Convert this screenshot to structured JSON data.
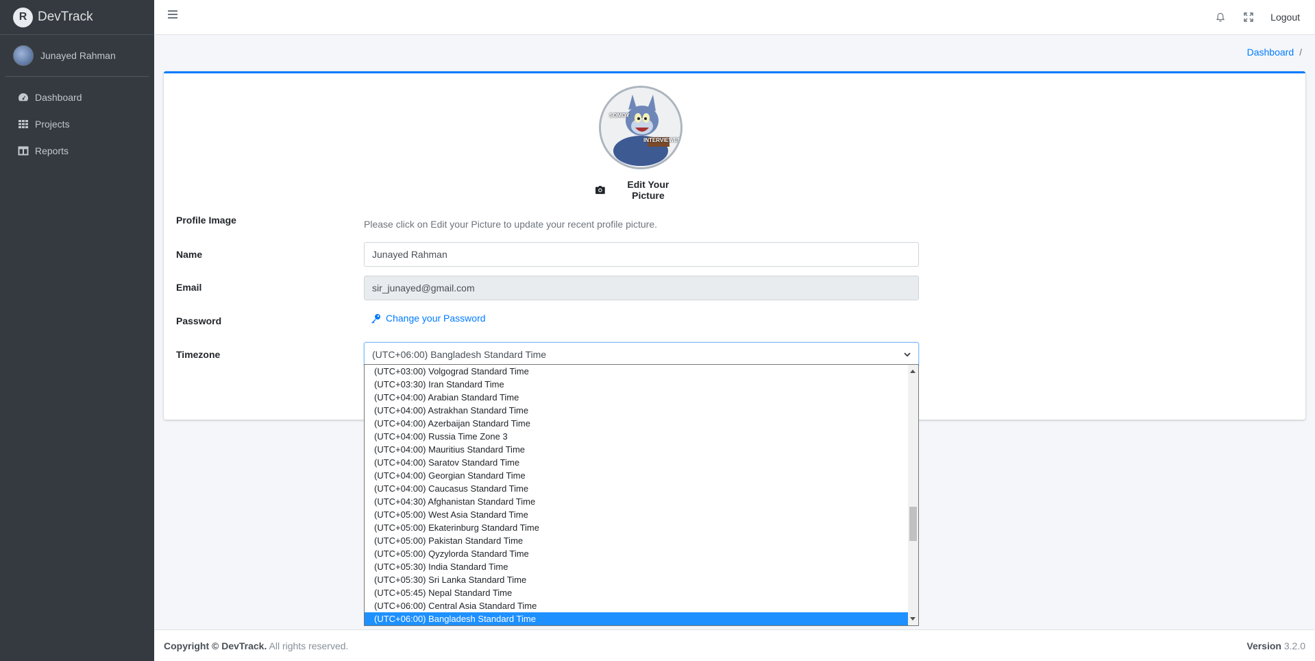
{
  "brand": {
    "name": "DevTrack",
    "logo_letter": "R"
  },
  "user": {
    "name": "Junayed Rahman"
  },
  "sidebar": {
    "items": [
      {
        "label": "Dashboard",
        "icon": "tachometer-icon"
      },
      {
        "label": "Projects",
        "icon": "grid-icon"
      },
      {
        "label": "Reports",
        "icon": "columns-icon"
      }
    ]
  },
  "topbar": {
    "logout_label": "Logout"
  },
  "breadcrumb": {
    "item": "Dashboard",
    "separator": "/"
  },
  "profile": {
    "picture_labels": {
      "top": "SOMOY",
      "bottom": "INTERVIEWER"
    },
    "edit_picture_label": "Edit Your Picture",
    "labels": {
      "profile_image": "Profile Image",
      "name": "Name",
      "email": "Email",
      "password": "Password",
      "timezone": "Timezone"
    },
    "profile_image_help": "Please click on Edit your Picture to update your recent profile picture.",
    "name_value": "Junayed Rahman",
    "email_value": "sir_junayed@gmail.com",
    "change_password_label": "Change your Password",
    "timezone_value": "(UTC+06:00) Bangladesh Standard Time"
  },
  "timezone_options": [
    "(UTC+03:00) Volgograd Standard Time",
    "(UTC+03:30) Iran Standard Time",
    "(UTC+04:00) Arabian Standard Time",
    "(UTC+04:00) Astrakhan Standard Time",
    "(UTC+04:00) Azerbaijan Standard Time",
    "(UTC+04:00) Russia Time Zone 3",
    "(UTC+04:00) Mauritius Standard Time",
    "(UTC+04:00) Saratov Standard Time",
    "(UTC+04:00) Georgian Standard Time",
    "(UTC+04:00) Caucasus Standard Time",
    "(UTC+04:30) Afghanistan Standard Time",
    "(UTC+05:00) West Asia Standard Time",
    "(UTC+05:00) Ekaterinburg Standard Time",
    "(UTC+05:00) Pakistan Standard Time",
    "(UTC+05:00) Qyzylorda Standard Time",
    "(UTC+05:30) India Standard Time",
    "(UTC+05:30) Sri Lanka Standard Time",
    "(UTC+05:45) Nepal Standard Time",
    "(UTC+06:00) Central Asia Standard Time",
    "(UTC+06:00) Bangladesh Standard Time"
  ],
  "selected_timezone_index": 19,
  "footer": {
    "copyright_prefix": "Copyright ©",
    "copyright_brand": "DevTrack.",
    "copyright_suffix": "All rights reserved.",
    "version_label": "Version",
    "version_value": "3.2.0"
  },
  "colors": {
    "accent": "#007bff",
    "sidebar_bg": "#343a40",
    "selected_option": "#1e90ff"
  }
}
